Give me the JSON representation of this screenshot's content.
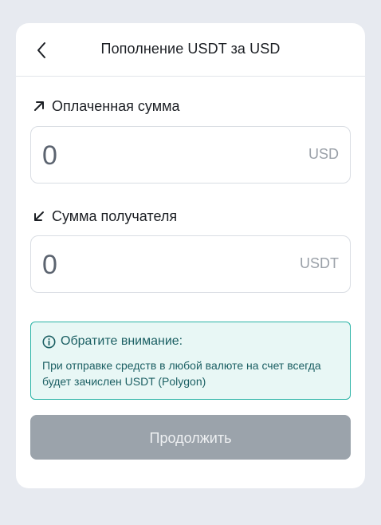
{
  "header": {
    "title": "Пополнение USDT за USD",
    "back_icon": "chevron-left-icon"
  },
  "paid": {
    "label": "Оплаченная сумма",
    "icon": "arrow-up-right-icon",
    "value": "0",
    "currency": "USD"
  },
  "received": {
    "label": "Сумма получателя",
    "icon": "arrow-down-left-icon",
    "value": "0",
    "currency": "USDT"
  },
  "notice": {
    "icon": "info-icon",
    "title": "Обратите внимание:",
    "text": "При отправке средств в любой валюте на счет всегда будет зачислен USDT (Polygon)"
  },
  "continue_label": "Продолжить",
  "colors": {
    "page_bg": "#e7eaf0",
    "card_bg": "#ffffff",
    "notice_bg": "#e8f7f5",
    "notice_border": "#2ab3a6",
    "notice_text": "#1b5f63",
    "button_disabled": "#9ba3ab"
  }
}
